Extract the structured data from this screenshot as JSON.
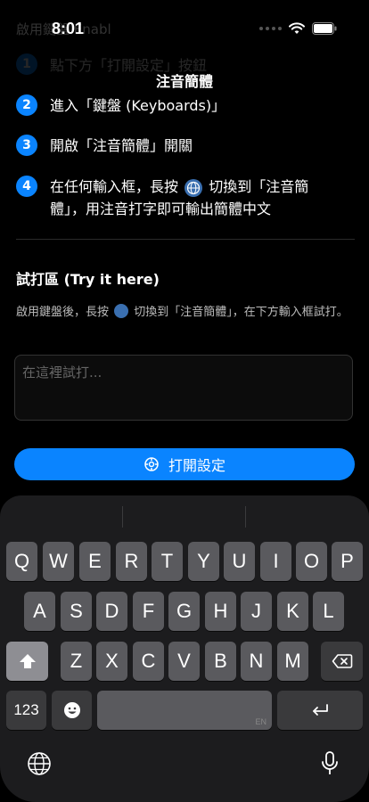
{
  "status_bar": {
    "time": "8:01",
    "icons": [
      "signal-icon",
      "wifi-icon",
      "battery-icon"
    ]
  },
  "faded_header": "啟用鍵盤 Enabl",
  "nav": {
    "title": "注音簡體"
  },
  "faded_step": {
    "number": "1",
    "text": "點下方「打開設定」按鈕"
  },
  "steps": [
    {
      "number": "2",
      "text": "進入「鍵盤 (Keyboards)」"
    },
    {
      "number": "3",
      "text": "開啟「注音簡體」開關"
    },
    {
      "number": "4",
      "text_before": "在任何輸入框，長按",
      "text_after": "切換到「注音簡體」，用注音打字即可輸出簡體中文"
    }
  ],
  "try_section": {
    "title": "試打區 (Try it here)",
    "desc_before": "啟用鍵盤後，長按",
    "desc_after": "切換到「注音簡體」，在下方輸入框試打。",
    "placeholder": "在這裡試打..."
  },
  "open_button": {
    "label": "打開設定",
    "icon": "gear-icon"
  },
  "keyboard": {
    "row1": [
      "Q",
      "W",
      "E",
      "R",
      "T",
      "Y",
      "U",
      "I",
      "O",
      "P"
    ],
    "row2": [
      "A",
      "S",
      "D",
      "F",
      "G",
      "H",
      "J",
      "K",
      "L"
    ],
    "row3": [
      "Z",
      "X",
      "C",
      "V",
      "B",
      "N",
      "M"
    ],
    "numbers_key": "123",
    "space_language": "EN",
    "accent": "#0a84ff"
  }
}
